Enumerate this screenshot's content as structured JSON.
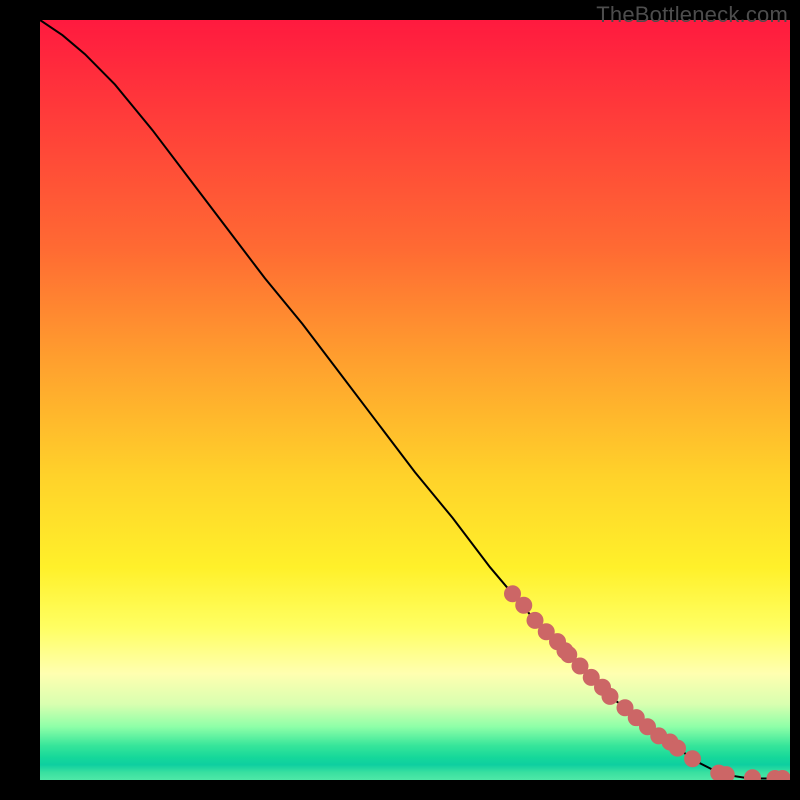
{
  "watermark": "TheBottleneck.com",
  "colors": {
    "curve_stroke": "#000000",
    "marker_fill": "#cc6666",
    "marker_stroke": "#cc6666"
  },
  "chart_data": {
    "type": "line",
    "title": "",
    "xlabel": "",
    "ylabel": "",
    "xlim": [
      0,
      100
    ],
    "ylim": [
      0,
      100
    ],
    "x": [
      0,
      3,
      6,
      10,
      15,
      20,
      25,
      30,
      35,
      40,
      45,
      50,
      55,
      60,
      63,
      66,
      68,
      70,
      72,
      74,
      76,
      78,
      80,
      82,
      84,
      86,
      88,
      90,
      92,
      94,
      96,
      98,
      100
    ],
    "y": [
      100,
      98,
      95.5,
      91.5,
      85.5,
      79,
      72.5,
      66,
      60,
      53.5,
      47,
      40.5,
      34.5,
      28,
      24.5,
      21,
      19,
      17,
      15,
      13,
      11,
      9.5,
      8,
      6.5,
      5,
      3.5,
      2.2,
      1.2,
      0.6,
      0.3,
      0.2,
      0.2,
      0.2
    ],
    "markers": {
      "x": [
        63,
        64.5,
        66,
        67.5,
        69,
        70,
        70.5,
        72,
        73.5,
        75,
        76,
        78,
        79.5,
        81,
        82.5,
        84,
        85,
        87,
        90.5,
        91.5,
        95,
        98,
        99
      ],
      "y": [
        24.5,
        23,
        21,
        19.5,
        18.2,
        17,
        16.5,
        15,
        13.5,
        12.2,
        11,
        9.5,
        8.2,
        7,
        5.8,
        5,
        4.2,
        2.8,
        0.9,
        0.7,
        0.3,
        0.2,
        0.2
      ]
    }
  }
}
